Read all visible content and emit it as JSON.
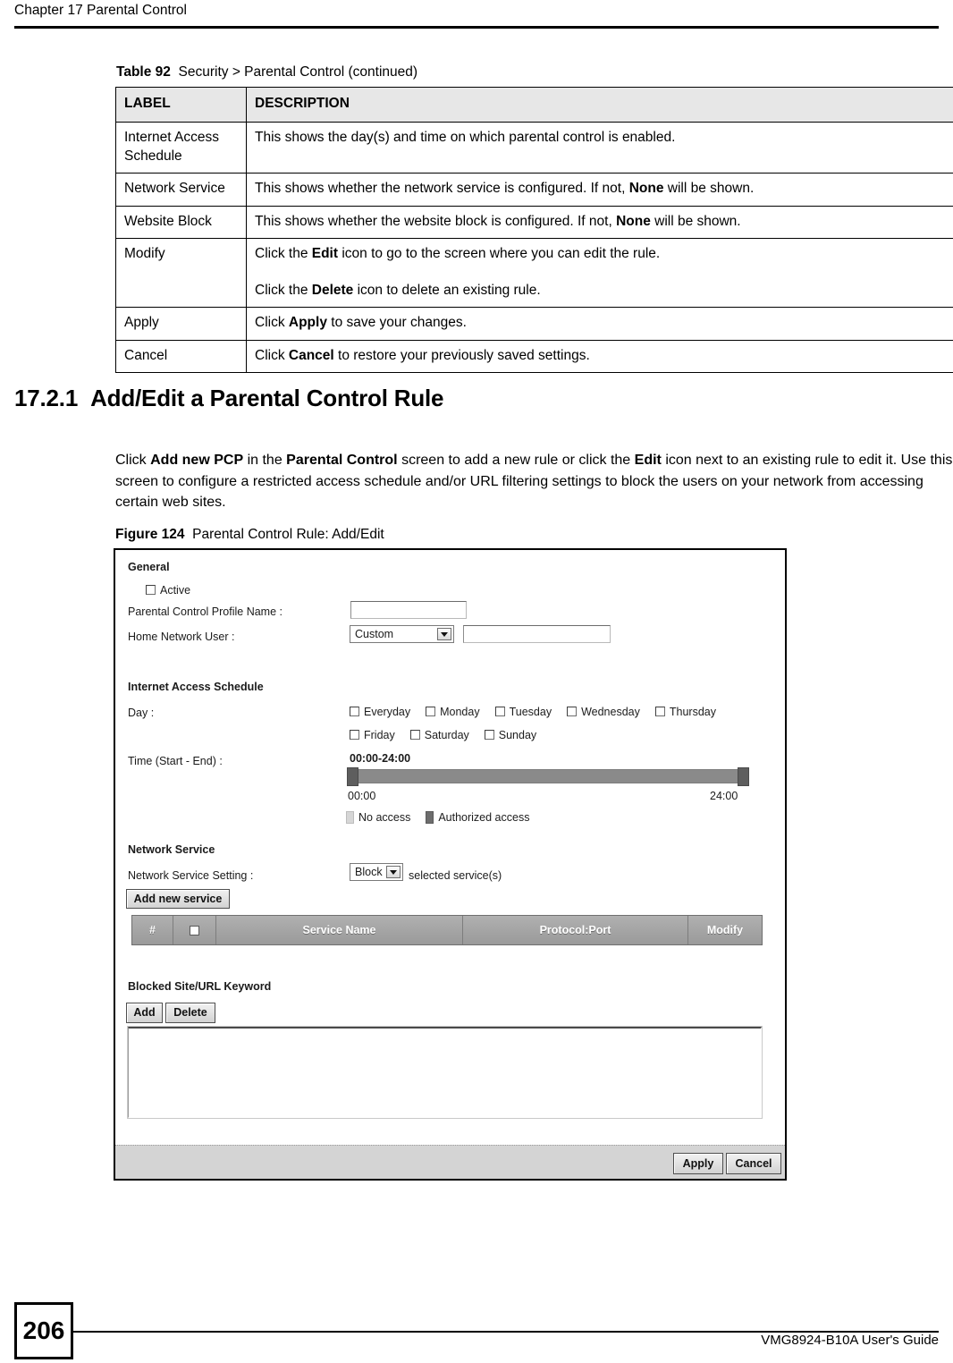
{
  "header": {
    "chapter": "Chapter 17 Parental Control"
  },
  "table": {
    "caption_number": "Table 92",
    "caption_text": "Security > Parental Control (continued)",
    "columns": [
      "LABEL",
      "DESCRIPTION"
    ],
    "rows": [
      {
        "label": "Internet Access Schedule",
        "description_parts": [
          {
            "paragraphs": [
              [
                {
                  "t": "This shows the day(s) and time on which parental control is enabled.",
                  "b": false
                }
              ]
            ]
          }
        ]
      },
      {
        "label": "Network Service",
        "description_parts": [
          {
            "paragraphs": [
              [
                {
                  "t": "This shows whether the network service is configured. If not, ",
                  "b": false
                },
                {
                  "t": "None",
                  "b": true
                },
                {
                  "t": " will be shown.",
                  "b": false
                }
              ]
            ]
          }
        ]
      },
      {
        "label": "Website Block",
        "description_parts": [
          {
            "paragraphs": [
              [
                {
                  "t": "This shows whether the website block is configured. If not, ",
                  "b": false
                },
                {
                  "t": "None",
                  "b": true
                },
                {
                  "t": " will be shown.",
                  "b": false
                }
              ]
            ]
          }
        ]
      },
      {
        "label": "Modify",
        "description_parts": [
          {
            "paragraphs": [
              [
                {
                  "t": "Click the ",
                  "b": false
                },
                {
                  "t": "Edit",
                  "b": true
                },
                {
                  "t": " icon to go to the screen where you can edit the rule.",
                  "b": false
                }
              ],
              [
                {
                  "t": "Click the ",
                  "b": false
                },
                {
                  "t": "Delete",
                  "b": true
                },
                {
                  "t": " icon to delete an existing rule.",
                  "b": false
                }
              ]
            ]
          }
        ]
      },
      {
        "label": "Apply",
        "description_parts": [
          {
            "paragraphs": [
              [
                {
                  "t": "Click ",
                  "b": false
                },
                {
                  "t": "Apply",
                  "b": true
                },
                {
                  "t": " to save your changes.",
                  "b": false
                }
              ]
            ]
          }
        ]
      },
      {
        "label": "Cancel",
        "description_parts": [
          {
            "paragraphs": [
              [
                {
                  "t": "Click ",
                  "b": false
                },
                {
                  "t": "Cancel",
                  "b": true
                },
                {
                  "t": " to restore your previously saved settings.",
                  "b": false
                }
              ]
            ]
          }
        ]
      }
    ]
  },
  "section": {
    "number": "17.2.1",
    "title": "Add/Edit a Parental Control Rule",
    "paragraph": [
      {
        "t": "Click ",
        "b": false
      },
      {
        "t": "Add new PCP",
        "b": true
      },
      {
        "t": " in the ",
        "b": false
      },
      {
        "t": "Parental Control",
        "b": true
      },
      {
        "t": " screen to add a new rule or click the ",
        "b": false
      },
      {
        "t": "Edit",
        "b": true
      },
      {
        "t": " icon next to an existing rule to edit it. Use this screen to configure a restricted access schedule and/or URL filtering settings to block the users on your network from accessing certain web sites.",
        "b": false
      }
    ]
  },
  "figure": {
    "caption_number": "Figure 124",
    "caption_text": "Parental Control Rule: Add/Edit"
  },
  "ui": {
    "general": {
      "title": "General",
      "active_label": "Active",
      "active_checked": false,
      "profile_name_label": "Parental Control Profile Name :",
      "profile_name_value": "",
      "home_network_user_label": "Home Network User :",
      "home_network_user_selected": "Custom",
      "home_network_user_custom_value": ""
    },
    "schedule": {
      "title": "Internet Access Schedule",
      "day_label": "Day :",
      "days_row1": [
        "Everyday",
        "Monday",
        "Tuesday",
        "Wednesday",
        "Thursday"
      ],
      "days_row2": [
        "Friday",
        "Saturday",
        "Sunday"
      ],
      "time_label": "Time (Start - End) :",
      "time_range": "00:00-24:00",
      "axis_start": "00:00",
      "axis_end": "24:00",
      "legend_no_access": "No access",
      "legend_authorized": "Authorized access"
    },
    "network_service": {
      "title": "Network Service",
      "setting_label": "Network Service Setting :",
      "setting_selected": "Block",
      "setting_suffix": "selected service(s)",
      "add_button": "Add new service",
      "table_headers": [
        "#",
        "",
        "Service Name",
        "Protocol:Port",
        "Modify"
      ]
    },
    "blocked_site": {
      "title": "Blocked Site/URL Keyword",
      "add_button": "Add",
      "delete_button": "Delete",
      "textarea_value": ""
    },
    "footer": {
      "apply_button": "Apply",
      "cancel_button": "Cancel"
    }
  },
  "page_footer": {
    "page_number": "206",
    "guide": "VMG8924-B10A User's Guide"
  }
}
